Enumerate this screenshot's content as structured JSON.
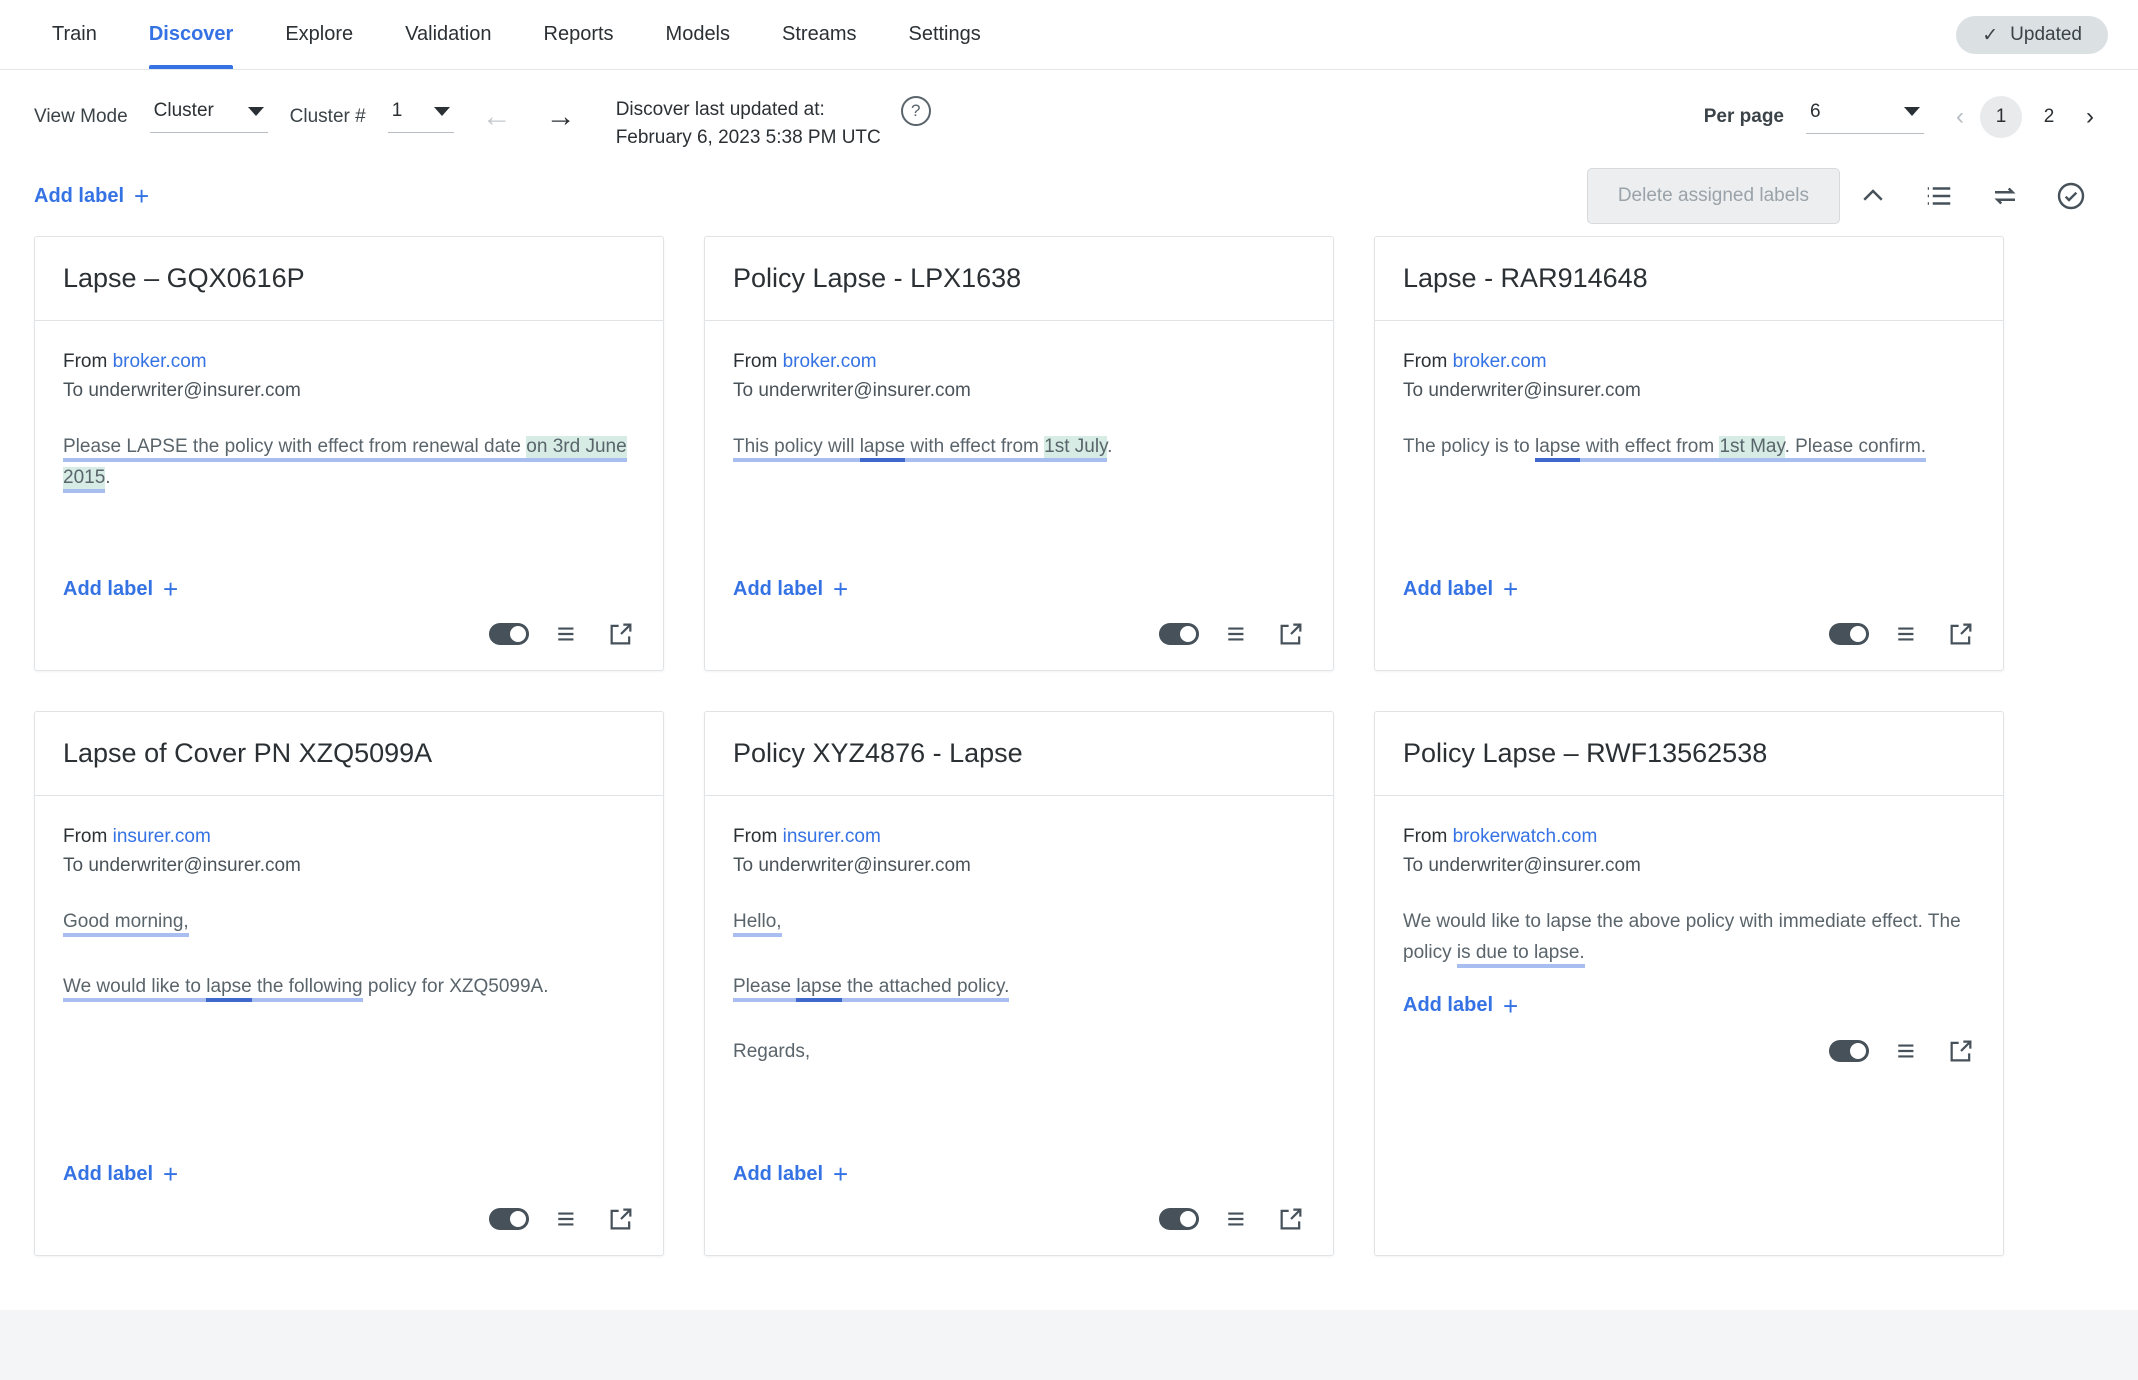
{
  "nav": {
    "tabs": [
      {
        "label": "Train",
        "active": false
      },
      {
        "label": "Discover",
        "active": true
      },
      {
        "label": "Explore",
        "active": false
      },
      {
        "label": "Validation",
        "active": false
      },
      {
        "label": "Reports",
        "active": false
      },
      {
        "label": "Models",
        "active": false
      },
      {
        "label": "Streams",
        "active": false
      },
      {
        "label": "Settings",
        "active": false
      }
    ],
    "status_badge": {
      "label": "Updated",
      "icon": "check-icon"
    }
  },
  "toolbar": {
    "view_mode_label": "View Mode",
    "view_mode_value": "Cluster",
    "cluster_num_label": "Cluster #",
    "cluster_num_value": "1",
    "prev_arrow_icon": "arrow-left-icon",
    "next_arrow_icon": "arrow-right-icon",
    "updated_line1": "Discover last updated at:",
    "updated_line2": "February 6, 2023 5:38 PM UTC",
    "help_icon": "question-mark-icon",
    "per_page_label": "Per page",
    "per_page_value": "6",
    "pagination": {
      "prev_icon": "chevron-left-icon",
      "next_icon": "chevron-right-icon",
      "pages": [
        "1",
        "2"
      ],
      "active_page": "1"
    },
    "add_label": "Add label",
    "plus_icon": "plus-icon",
    "delete_button": "Delete assigned labels",
    "icons": [
      "chevron-up-icon",
      "list-icon",
      "swap-arrows-icon",
      "check-circle-icon"
    ]
  },
  "accent_colors": {
    "brand_blue": "#3572e3",
    "underline_light": "#a8bef0",
    "underline_dark": "#3e68cc",
    "highlight_mint": "#d6ece4",
    "badge_grey": "#dbe0e3"
  },
  "cards": [
    {
      "title": "Lapse – GQX0616P",
      "from_label": "From",
      "from_domain": "broker.com",
      "to_line": "To underwriter@insurer.com",
      "add_label": "Add label",
      "body_text": "Please LAPSE the policy with effect from renewal date on 3rd June 2015.",
      "paragraphs": [
        {
          "runs": [
            {
              "text": "Please LAPSE the policy with effect from renewal date ",
              "style": "u"
            },
            {
              "text": "on 3rd June 2015",
              "style": "hl-u"
            },
            {
              "text": ".",
              "style": "none"
            }
          ]
        }
      ]
    },
    {
      "title": "Policy Lapse - LPX1638",
      "from_label": "From",
      "from_domain": "broker.com",
      "to_line": "To underwriter@insurer.com",
      "add_label": "Add label",
      "body_text": "This policy will lapse with effect from 1st July.",
      "paragraphs": [
        {
          "runs": [
            {
              "text": "This policy will ",
              "style": "u"
            },
            {
              "text": "lapse",
              "style": "u2"
            },
            {
              "text": " with effect from ",
              "style": "u"
            },
            {
              "text": "1st July",
              "style": "hl-u"
            },
            {
              "text": ".",
              "style": "none"
            }
          ]
        }
      ]
    },
    {
      "title": "Lapse - RAR914648",
      "from_label": "From",
      "from_domain": "broker.com",
      "to_line": "To underwriter@insurer.com",
      "add_label": "Add label",
      "body_text": "The policy is to lapse with effect from 1st May. Please confirm.",
      "paragraphs": [
        {
          "runs": [
            {
              "text": "The policy is to ",
              "style": "none"
            },
            {
              "text": "lapse",
              "style": "u2"
            },
            {
              "text": " with effect from ",
              "style": "u"
            },
            {
              "text": "1st May",
              "style": "hl-u"
            },
            {
              "text": ". Please confirm.",
              "style": "u"
            }
          ]
        }
      ]
    },
    {
      "title": "Lapse of Cover PN XZQ5099A",
      "from_label": "From",
      "from_domain": "insurer.com",
      "to_line": "To underwriter@insurer.com",
      "add_label": "Add label",
      "body_text": "Good morning, We would like to lapse the following policy for XZQ5099A.",
      "paragraphs": [
        {
          "runs": [
            {
              "text": "Good morning,",
              "style": "u"
            }
          ]
        },
        {
          "runs": [
            {
              "text": "We would like to ",
              "style": "u"
            },
            {
              "text": "lapse",
              "style": "u2"
            },
            {
              "text": " the following",
              "style": "u"
            },
            {
              "text": " policy for XZQ5099A.",
              "style": "none"
            }
          ]
        }
      ]
    },
    {
      "title": "Policy XYZ4876 - Lapse",
      "from_label": "From",
      "from_domain": "insurer.com",
      "to_line": "To underwriter@insurer.com",
      "add_label": "Add label",
      "body_text": "Hello, Please lapse the attached policy. Regards,",
      "paragraphs": [
        {
          "runs": [
            {
              "text": "Hello,",
              "style": "u"
            }
          ]
        },
        {
          "runs": [
            {
              "text": "Please ",
              "style": "u"
            },
            {
              "text": "lapse",
              "style": "u2"
            },
            {
              "text": " the attached policy.",
              "style": "u"
            }
          ]
        },
        {
          "runs": [
            {
              "text": "Regards,",
              "style": "none"
            }
          ]
        }
      ]
    },
    {
      "title": "Policy Lapse – RWF13562538",
      "from_label": "From",
      "from_domain": "brokerwatch.com",
      "to_line": "To underwriter@insurer.com",
      "add_label": "Add label",
      "body_text": "We would like to lapse the above policy with immediate effect. The policy is due to lapse.",
      "paragraphs": [
        {
          "runs": [
            {
              "text": "We would like to lapse the above policy with immediate effect. The policy ",
              "style": "none"
            },
            {
              "text": "is due to lapse.",
              "style": "u"
            }
          ]
        }
      ]
    }
  ],
  "card_footer_icons": [
    "toggle-switch",
    "list-lines-icon",
    "external-link-icon"
  ]
}
